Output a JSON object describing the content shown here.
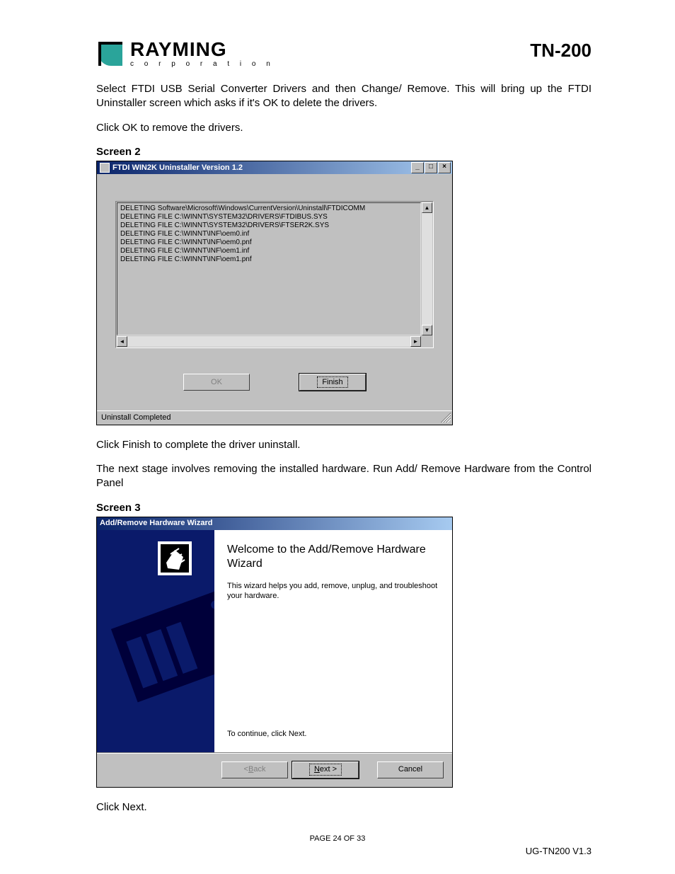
{
  "header": {
    "logo_name": "RAYMING",
    "logo_sub": "c o r p o r a t i o n",
    "model": "TN-200"
  },
  "body": {
    "p1": "Select FTDI USB Serial Converter Drivers and then Change/ Remove.  This will bring up the FTDI Uninstaller screen which asks if it's OK to delete the drivers.",
    "p2": "Click OK to remove the drivers.",
    "screen2_label": "Screen 2",
    "p3": "Click Finish to complete the driver uninstall.",
    "p4": "The next stage involves removing the installed hardware.  Run Add/ Remove Hardware from the Control Panel",
    "screen3_label": "Screen 3",
    "p5": "Click Next."
  },
  "win1": {
    "title": "FTDI WIN2K Uninstaller Version 1.2",
    "log": [
      "DELETING Software\\Microsoft\\Windows\\CurrentVersion\\Uninstall\\FTDICOMM",
      "DELETING FILE C:\\WINNT\\SYSTEM32\\DRIVERS\\FTDIBUS.SYS",
      "DELETING FILE C:\\WINNT\\SYSTEM32\\DRIVERS\\FTSER2K.SYS",
      "DELETING FILE C:\\WINNT\\INF\\oem0.inf",
      "DELETING FILE C:\\WINNT\\INF\\oem0.pnf",
      "DELETING FILE C:\\WINNT\\INF\\oem1.inf",
      "DELETING FILE C:\\WINNT\\INF\\oem1.pnf"
    ],
    "ok": "OK",
    "finish": "Finish",
    "status": "Uninstall Completed"
  },
  "wizard": {
    "title": "Add/Remove Hardware Wizard",
    "heading": "Welcome to the Add/Remove Hardware Wizard",
    "desc": "This wizard helps you add, remove, unplug, and troubleshoot your hardware.",
    "continue": "To continue, click Next.",
    "back_prefix": "< ",
    "back_letter": "B",
    "back_rest": "ack",
    "next_letter": "N",
    "next_rest": "ext >",
    "cancel": "Cancel"
  },
  "footer": {
    "page": "PAGE 24 OF 33",
    "doc": "UG-TN200 V1.3"
  }
}
